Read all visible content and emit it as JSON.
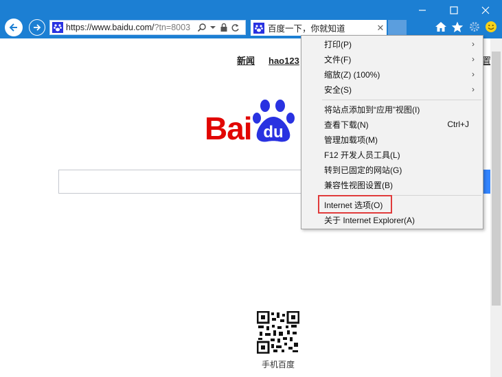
{
  "address_bar": {
    "url_main": "https://www.baidu.com/",
    "url_rest": "?tn=8003"
  },
  "tab": {
    "title": "百度一下，你就知道",
    "close_glyph": "✕"
  },
  "page": {
    "nav_links": [
      "新闻",
      "hao123"
    ],
    "settings_link": "置",
    "logo_text": "Bai",
    "logo_du": "du",
    "qr_label": "手机百度"
  },
  "menu": {
    "items": [
      {
        "label": "打印(P)",
        "submenu": true
      },
      {
        "label": "文件(F)",
        "submenu": true
      },
      {
        "label": "缩放(Z) (100%)",
        "submenu": true
      },
      {
        "label": "安全(S)",
        "submenu": true
      },
      {
        "label": "将站点添加到“应用”视图(I)"
      },
      {
        "label": "查看下载(N)",
        "shortcut": "Ctrl+J"
      },
      {
        "label": "管理加载项(M)"
      },
      {
        "label": "F12 开发人员工具(L)"
      },
      {
        "label": "转到已固定的网站(G)"
      },
      {
        "label": "兼容性视图设置(B)"
      },
      {
        "label": "Internet 选项(O)",
        "highlighted": true
      },
      {
        "label": "关于 Internet Explorer(A)"
      }
    ],
    "arrow_glyph": "›"
  },
  "colors": {
    "title_bar": "#1c7fd3",
    "highlight_border": "#e03a3a",
    "baidu_red": "#e10602",
    "baidu_blue": "#2932e1"
  },
  "icons": [
    "back-arrow-icon",
    "forward-arrow-icon",
    "baidu-paw-icon",
    "search-icon",
    "dropdown-icon",
    "lock-icon",
    "refresh-icon",
    "home-icon",
    "favorites-star-icon",
    "tools-gear-icon",
    "smiley-feedback-icon",
    "minimize-icon",
    "maximize-icon",
    "close-icon"
  ]
}
